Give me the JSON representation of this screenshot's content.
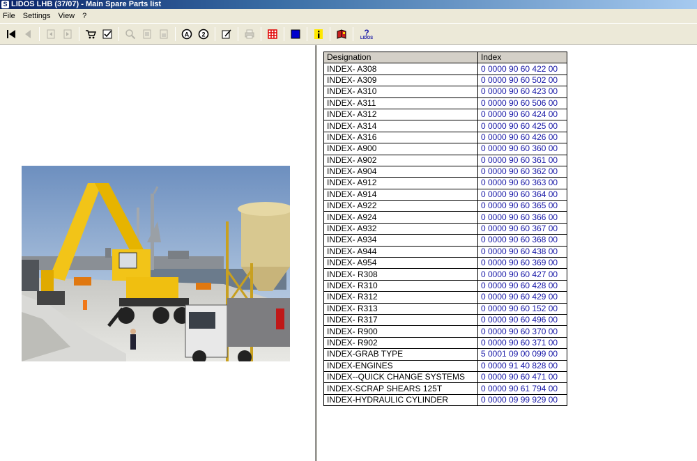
{
  "window": {
    "title": "LIDOS LHB  (37/07) - Main Spare Parts list",
    "app_icon_glyph": "S"
  },
  "menu": {
    "items": [
      "File",
      "Settings",
      "View",
      "?"
    ]
  },
  "toolbar": {
    "buttons": [
      {
        "name": "first-record-icon",
        "glyph": "⏮",
        "enabled": true
      },
      {
        "name": "previous-record-icon",
        "glyph": "◀",
        "enabled": false
      },
      {
        "name": "page-back-icon",
        "glyph": "⇤",
        "enabled": false
      },
      {
        "name": "page-forward-icon",
        "glyph": "⇥",
        "enabled": false
      },
      {
        "name": "cart-icon",
        "glyph": "🛒",
        "enabled": true
      },
      {
        "name": "checklist-icon",
        "glyph": "☑",
        "enabled": true
      },
      {
        "name": "zoom-icon",
        "glyph": "🔍",
        "enabled": false
      },
      {
        "name": "copy-page-icon",
        "glyph": "❐",
        "enabled": false
      },
      {
        "name": "paste-page-icon",
        "glyph": "❏",
        "enabled": false
      },
      {
        "name": "marker-a-icon",
        "glyph": "Ⓐ",
        "enabled": true
      },
      {
        "name": "marker-2-icon",
        "glyph": "②",
        "enabled": true
      },
      {
        "name": "edit-note-icon",
        "glyph": "✎",
        "enabled": true
      },
      {
        "name": "print-icon",
        "glyph": "⎙",
        "enabled": false
      },
      {
        "name": "grid-icon",
        "glyph": "▦",
        "enabled": true
      },
      {
        "name": "blue-square-icon",
        "glyph": "■",
        "enabled": true
      },
      {
        "name": "info-icon",
        "glyph": "i",
        "enabled": true
      },
      {
        "name": "book-icon",
        "glyph": "📕",
        "enabled": true
      },
      {
        "name": "lidos-help-icon",
        "glyph": "?",
        "enabled": true
      }
    ],
    "lidos_label": "LIDOS"
  },
  "colors": {
    "index_text": "#1a1aa8",
    "header_bg": "#d4d0c8",
    "window_bg": "#ece9d8",
    "grid_icon": "#e00000",
    "blue_square_icon": "#0000cc",
    "info_icon_bg": "#ffe800"
  },
  "table": {
    "headers": {
      "designation": "Designation",
      "index": "Index"
    },
    "rows": [
      {
        "designation": "INDEX- A308",
        "index": "0 0000  90 60 422 00"
      },
      {
        "designation": "INDEX- A309",
        "index": "0 0000  90 60 502 00"
      },
      {
        "designation": "INDEX- A310",
        "index": "0 0000  90 60 423 00"
      },
      {
        "designation": "INDEX- A311",
        "index": "0 0000  90 60 506 00"
      },
      {
        "designation": "INDEX- A312",
        "index": "0 0000  90 60 424 00"
      },
      {
        "designation": "INDEX- A314",
        "index": "0 0000  90 60 425 00"
      },
      {
        "designation": "INDEX- A316",
        "index": "0 0000  90 60 426 00"
      },
      {
        "designation": "INDEX- A900",
        "index": "0 0000  90 60 360 00"
      },
      {
        "designation": "INDEX- A902",
        "index": "0 0000  90 60 361 00"
      },
      {
        "designation": "INDEX- A904",
        "index": "0 0000  90 60 362 00"
      },
      {
        "designation": "INDEX- A912",
        "index": "0 0000  90 60 363 00"
      },
      {
        "designation": "INDEX- A914",
        "index": "0 0000  90 60 364 00"
      },
      {
        "designation": "INDEX- A922",
        "index": "0 0000  90 60 365 00"
      },
      {
        "designation": "INDEX- A924",
        "index": "0 0000  90 60 366 00"
      },
      {
        "designation": "INDEX- A932",
        "index": "0 0000  90 60 367 00"
      },
      {
        "designation": "INDEX- A934",
        "index": "0 0000  90 60 368 00"
      },
      {
        "designation": "INDEX- A944",
        "index": "0 0000  90 60 438 00"
      },
      {
        "designation": "INDEX- A954",
        "index": "0 0000  90 60 369 00"
      },
      {
        "designation": "INDEX- R308",
        "index": "0 0000  90 60 427 00"
      },
      {
        "designation": "INDEX- R310",
        "index": "0 0000  90 60 428 00"
      },
      {
        "designation": "INDEX- R312",
        "index": "0 0000  90 60 429 00"
      },
      {
        "designation": "INDEX- R313",
        "index": "0 0000  90 60 152 00"
      },
      {
        "designation": "INDEX- R317",
        "index": "0 0000  90 60 496 00"
      },
      {
        "designation": "INDEX- R900",
        "index": "0 0000  90 60 370 00"
      },
      {
        "designation": "INDEX- R902",
        "index": "0 0000  90 60 371 00"
      },
      {
        "designation": "INDEX-GRAB TYPE",
        "index": "5 0001  09 00 099 00"
      },
      {
        "designation": "INDEX-ENGINES",
        "index": "0 0000  91 40 828 00"
      },
      {
        "designation": "INDEX--QUICK CHANGE SYSTEMS",
        "index": "0 0000  90 60 471 00"
      },
      {
        "designation": "INDEX-SCRAP SHEARS 125T",
        "index": "0 0000  90 61 794 00"
      },
      {
        "designation": "INDEX-HYDRAULIC CYLINDER",
        "index": "0 0000  09 99 929 00"
      }
    ]
  }
}
